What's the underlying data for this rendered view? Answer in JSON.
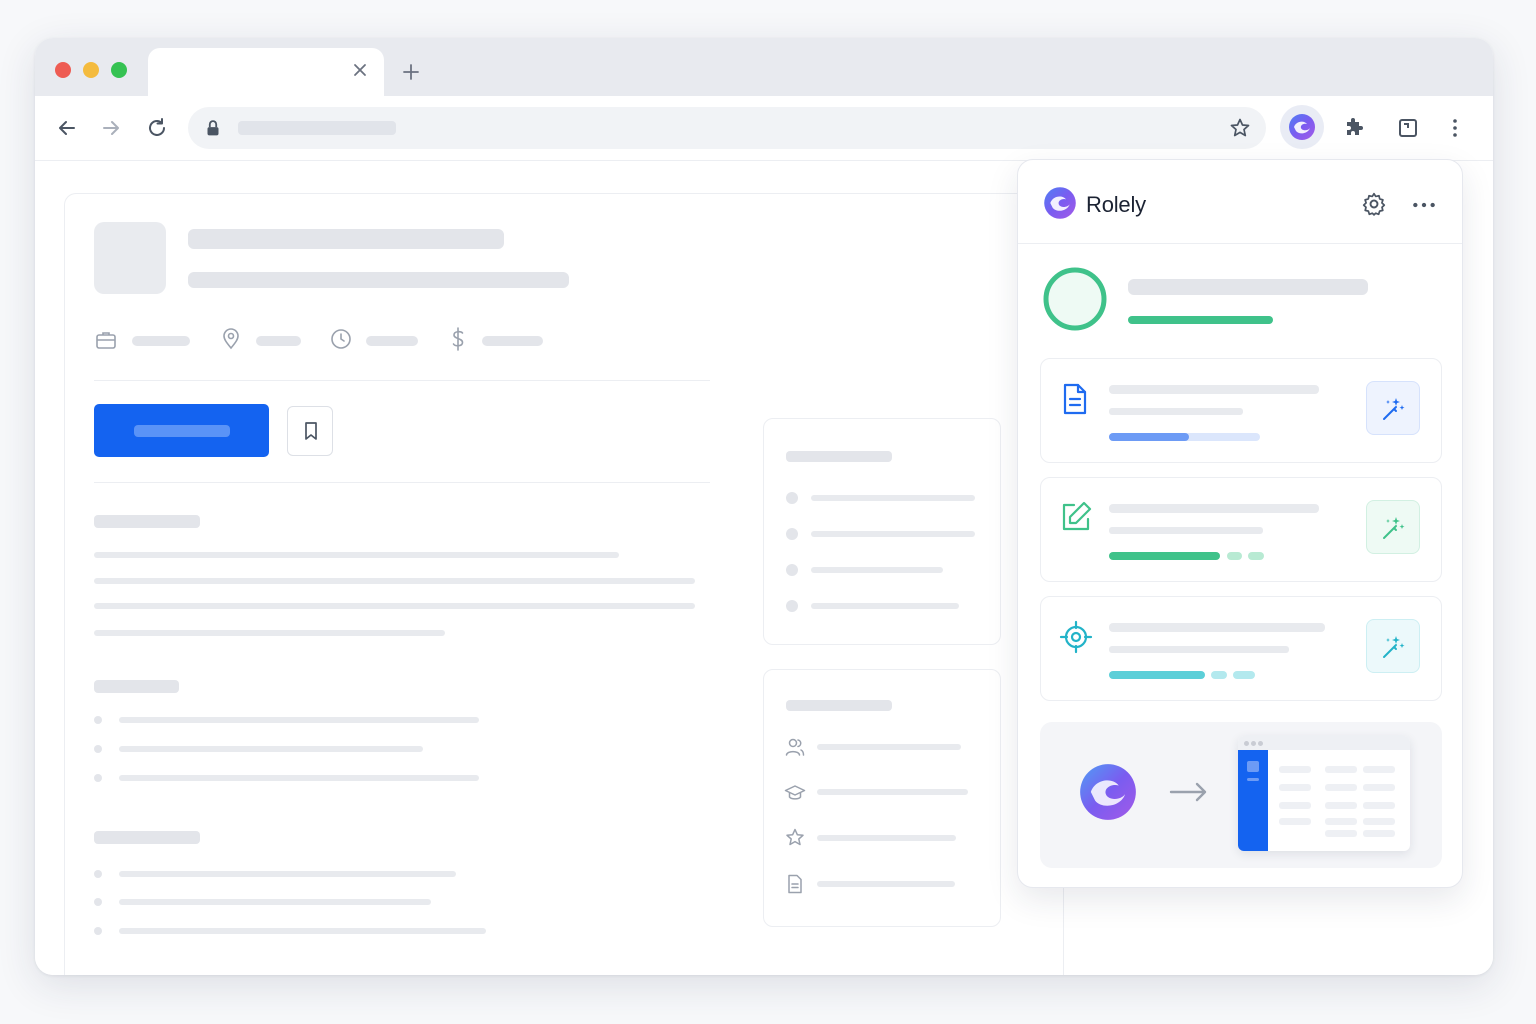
{
  "browser": {
    "traffic_lights": [
      "#ee5c53",
      "#f4bb3e",
      "#35c252"
    ],
    "tab": {
      "title": "",
      "close_icon": "close-icon"
    },
    "new_tab_icon": "plus-icon",
    "nav": {
      "back_icon": "arrow-left-icon",
      "forward_icon": "arrow-right-icon",
      "reload_icon": "reload-icon"
    },
    "address_bar": {
      "url": "",
      "lock_icon": "lock-icon",
      "bookmark_icon": "star-icon"
    },
    "toolbar_icons": [
      "rolely-extension-icon",
      "puzzle-icon",
      "side-panel-icon",
      "more-vertical-icon"
    ]
  },
  "job_page": {
    "meta_icons": [
      "briefcase-icon",
      "location-pin-icon",
      "clock-icon",
      "dollar-icon"
    ],
    "apply_button": {
      "label": "",
      "color": "#1463f0"
    },
    "save_icon": "bookmark-icon",
    "side_info_icons": [
      "users-icon",
      "graduation-cap-icon",
      "star-icon",
      "document-icon"
    ]
  },
  "extension_popup": {
    "title": "Rolely",
    "settings_icon": "gear-icon",
    "more_icon": "more-horizontal-icon",
    "progress_ring_color": "#3fc28a",
    "tools": [
      {
        "icon": "document-icon",
        "color": "#1f6bf0",
        "progress": 0.53
      },
      {
        "icon": "edit-icon",
        "color": "#3fc28a",
        "progress": 0.7
      },
      {
        "icon": "target-icon",
        "color": "#22b3c8",
        "progress": 0.61
      }
    ],
    "illustration": {
      "arrow_icon": "arrow-right-icon"
    }
  }
}
